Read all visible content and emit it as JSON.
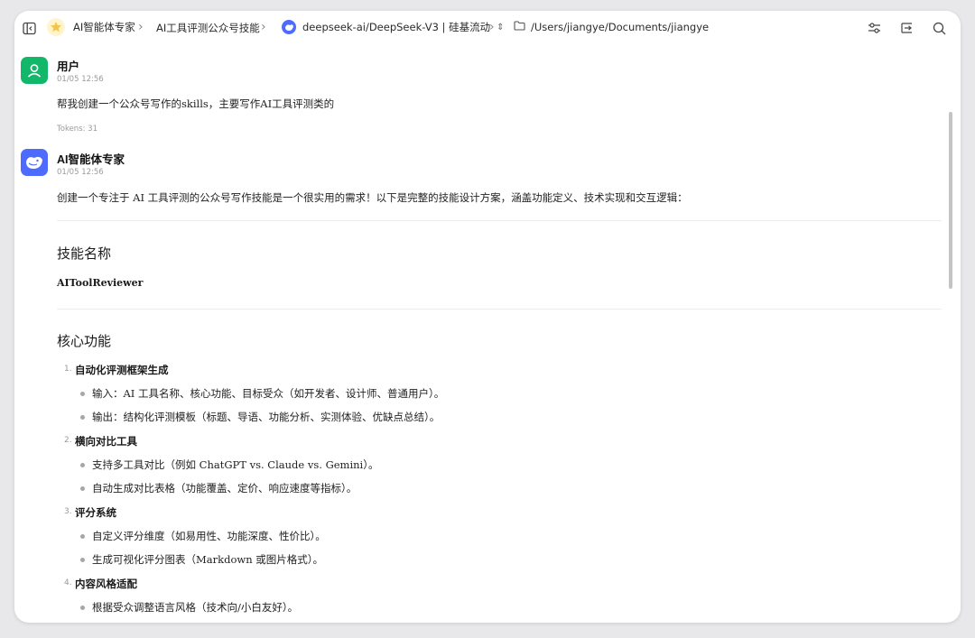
{
  "breadcrumb": {
    "agent": "AI智能体专家",
    "skill": "AI工具评测公众号技能",
    "model": "deepseek-ai/DeepSeek-V3 | 硅基流动",
    "path": "/Users/jiangye/Documents/jiangye"
  },
  "messages": {
    "user": {
      "name": "用户",
      "time": "01/05 12:56",
      "text": "帮我创建一个公众号写作的skills，主要写作AI工具评测类的",
      "tokens": "Tokens: 31"
    },
    "assistant": {
      "name": "AI智能体专家",
      "time": "01/05 12:56",
      "intro": "创建一个专注于 AI 工具评测的公众号写作技能是一个很实用的需求！以下是完整的技能设计方案，涵盖功能定义、技术实现和交互逻辑：",
      "section1_title": "技能名称",
      "skill_name": "AIToolReviewer",
      "section2_title": "核心功能",
      "features": [
        {
          "num": "1.",
          "title": "自动化评测框架生成",
          "items": [
            "输入：AI 工具名称、核心功能、目标受众（如开发者、设计师、普通用户）。",
            "输出：结构化评测模板（标题、导语、功能分析、实测体验、优缺点总结）。"
          ]
        },
        {
          "num": "2.",
          "title": "横向对比工具",
          "items": [
            "支持多工具对比（例如 ChatGPT vs. Claude vs. Gemini）。",
            "自动生成对比表格（功能覆盖、定价、响应速度等指标）。"
          ]
        },
        {
          "num": "3.",
          "title": "评分系统",
          "items": [
            "自定义评分维度（如易用性、功能深度、性价比）。",
            "生成可视化评分图表（Markdown 或图片格式）。"
          ]
        },
        {
          "num": "4.",
          "title": "内容风格适配",
          "items": [
            "根据受众调整语言风格（技术向/小白友好）。"
          ]
        }
      ]
    }
  },
  "colors": {
    "user_avatar": "#12b76a",
    "assistant_avatar": "#4d6bfe"
  }
}
